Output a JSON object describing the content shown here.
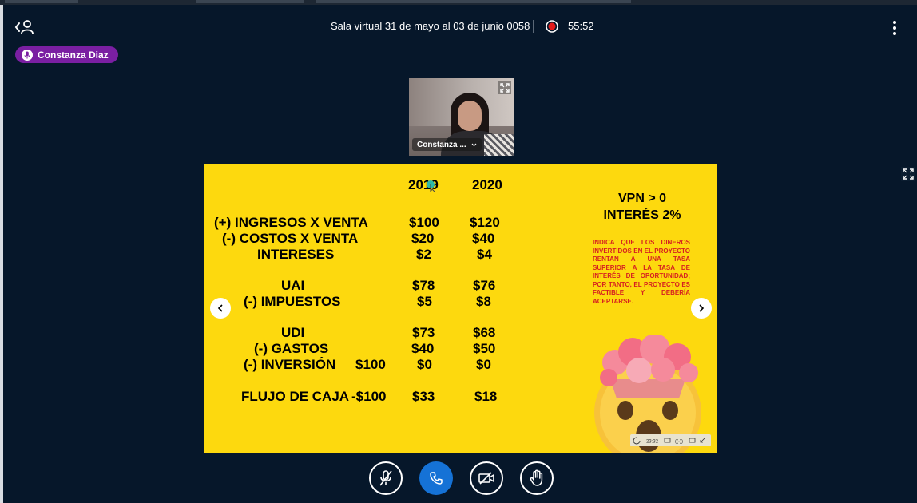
{
  "header": {
    "title": "Sala virtual 31 de mayo al 03 de junio 0058",
    "timer": "55:52",
    "back_icon": "user-back-icon",
    "recording_icon": "record-icon",
    "more_icon": "more-vertical-icon"
  },
  "speaker": {
    "name": "Constanza Diaz",
    "icon": "mic-icon"
  },
  "video": {
    "name": "Constanza ...",
    "icon": "chevron-down-icon"
  },
  "slide": {
    "year1": "2019",
    "year2": "2020",
    "rows": [
      {
        "label": "(+) INGRESOS X VENTA",
        "v1": "$100",
        "v2": "$120"
      },
      {
        "label": "(-) COSTOS X VENTA",
        "v1": "$20",
        "v2": "$40"
      },
      {
        "label": "INTERESES",
        "v1": "$2",
        "v2": "$4"
      },
      {
        "label": "UAI",
        "v1": "$78",
        "v2": "$76"
      },
      {
        "label": "(-) IMPUESTOS",
        "v1": "$5",
        "v2": "$8"
      },
      {
        "label": "UDI",
        "v1": "$73",
        "v2": "$68"
      },
      {
        "label": "(-) GASTOS",
        "v1": "$40",
        "v2": "$50"
      },
      {
        "label": "(-) INVERSIÓN",
        "v0": "$100",
        "v1": "$0",
        "v2": "$0"
      },
      {
        "label": "FLUJO DE CAJA",
        "v0": "-$100",
        "v1": "$33",
        "v2": "$18"
      }
    ],
    "vpn": "VPN > 0",
    "interes": "INTERÉS 2%",
    "note": "INDICA QUE LOS DINEROS INVERTIDOS EN EL PROYECTO RENTAN A UNA TASA SUPERIOR A LA TASA DE INTERÉS DE OPORTUNIDAD; POR TANTO, EL PROYECTO ES FACTIBLE Y DEBERÍA ACEPTARSE.",
    "player_time": "23:32"
  },
  "controls": {
    "mute_icon": "mic-muted-icon",
    "phone_icon": "phone-icon",
    "camera_icon": "camera-off-icon",
    "hand_icon": "raise-hand-icon"
  },
  "colors": {
    "background": "#06172a",
    "slide": "#fdd90e",
    "speaker_pill": "#7a1fa2",
    "phone": "#1572d6",
    "note": "#d62020"
  }
}
